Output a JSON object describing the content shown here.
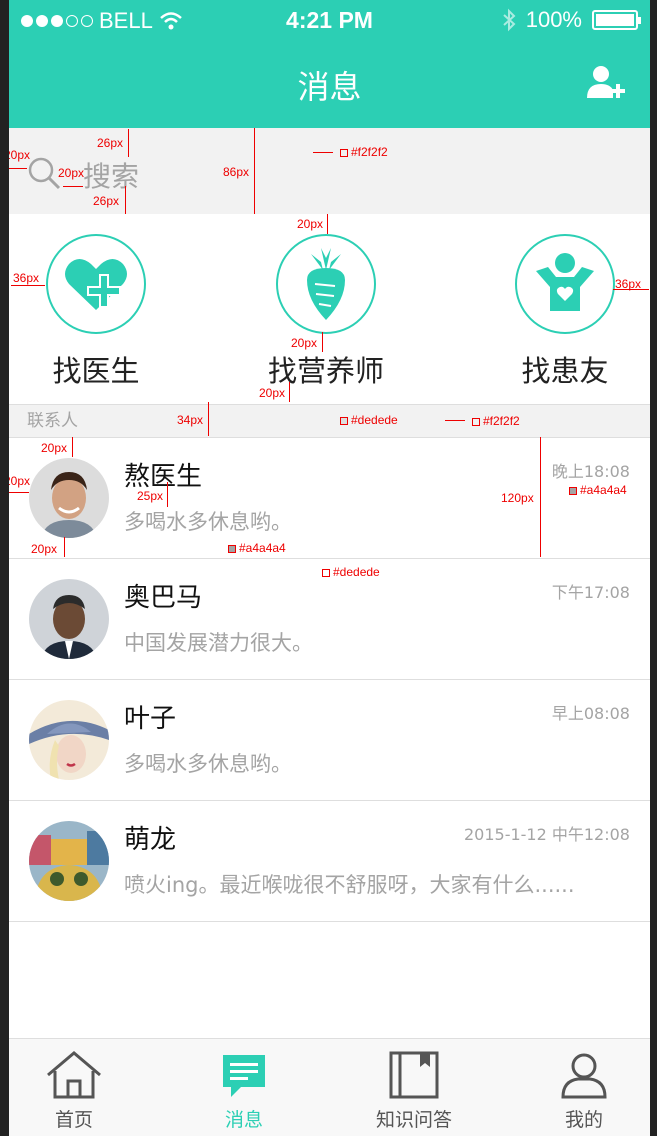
{
  "status": {
    "carrier": "BELL",
    "time": "4:21 PM",
    "battery": "100%",
    "signal_bars": 3
  },
  "nav": {
    "title": "消息"
  },
  "search": {
    "placeholder": "搜索"
  },
  "categories": [
    {
      "label": "找医生",
      "icon": "heart-plus-icon"
    },
    {
      "label": "找营养师",
      "icon": "radish-icon"
    },
    {
      "label": "找患友",
      "icon": "person-heart-icon"
    }
  ],
  "section_title": "联系人",
  "contacts": [
    {
      "name": "熬医生",
      "message": "多喝水多休息哟。",
      "time": "晚上18:08"
    },
    {
      "name": "奥巴马",
      "message": "中国发展潜力很大。",
      "time": "下午17:08"
    },
    {
      "name": "叶子",
      "message": "多喝水多休息哟。",
      "time": "早上08:08"
    },
    {
      "name": "萌龙",
      "message": "喷火ing。最近喉咙很不舒服呀，大家有什么......",
      "time": "2015-1-12 中午12:08"
    }
  ],
  "tabs": [
    {
      "label": "首页",
      "icon": "home-icon"
    },
    {
      "label": "消息",
      "icon": "message-icon"
    },
    {
      "label": "知识问答",
      "icon": "book-icon"
    },
    {
      "label": "我的",
      "icon": "user-icon"
    }
  ],
  "annotations": {
    "a20": "20px",
    "a26": "26px",
    "a86": "86px",
    "a36": "36px",
    "a34": "34px",
    "a25": "25px",
    "a120": "120px",
    "c_f2": "#f2f2f2",
    "c_de": "#dedede",
    "c_a4": "#a4a4a4"
  },
  "colors": {
    "accent": "#2ccfb4",
    "bg_gray": "#f2f2f2",
    "divider": "#dedede",
    "text_gray": "#a4a4a4"
  }
}
